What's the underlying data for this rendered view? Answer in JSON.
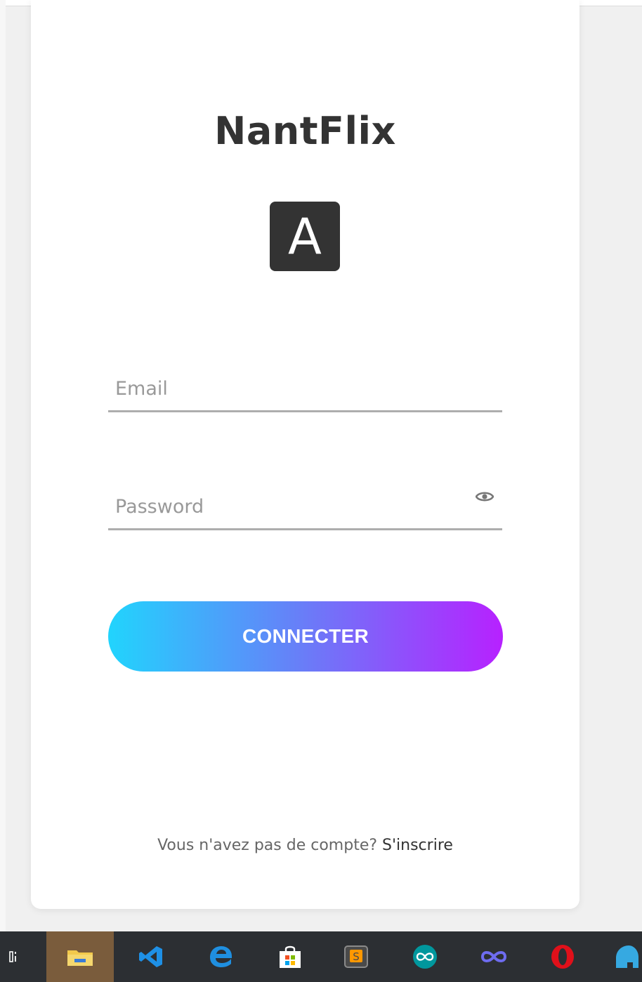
{
  "app": {
    "title": "NantFlix",
    "logo_letter": "A"
  },
  "form": {
    "email_placeholder": "Email",
    "password_placeholder": "Password",
    "submit_label": "CONNECTER"
  },
  "signup": {
    "prompt": "Vous n'avez pas de compte?",
    "link_label": "S'inscrire"
  },
  "colors": {
    "gradient_start": "#21d4fd",
    "gradient_end": "#b721ff",
    "title": "#333333"
  },
  "taskbar": {
    "icons": [
      "task-view-icon",
      "file-explorer-icon",
      "vscode-icon",
      "edge-icon",
      "store-icon",
      "sublime-text-icon",
      "arduino-icon",
      "infinity-app-icon",
      "opera-icon",
      "blue-app-icon"
    ]
  }
}
